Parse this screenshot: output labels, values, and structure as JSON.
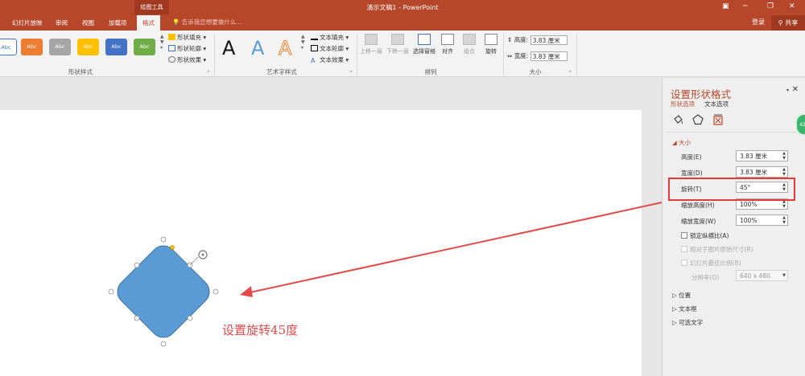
{
  "titlebar": {
    "doc_title": "演示文稿1 - PowerPoint",
    "context_label": "绘图工具",
    "tell_me": "告诉我您想要做什么...",
    "login": "登录",
    "share": "共享"
  },
  "tabs": [
    {
      "label": "幻灯片放映"
    },
    {
      "label": "审阅"
    },
    {
      "label": "视图"
    },
    {
      "label": "加载项"
    },
    {
      "label": "格式"
    }
  ],
  "ribbon": {
    "shape_styles": [
      {
        "label": "Abc",
        "color": "#ffffff"
      },
      {
        "label": "Abc",
        "color": "#ed7d31"
      },
      {
        "label": "Abc",
        "color": "#a5a5a5"
      },
      {
        "label": "Abc",
        "color": "#ffc000"
      },
      {
        "label": "Abc",
        "color": "#4472c4"
      },
      {
        "label": "Abc",
        "color": "#70ad47"
      }
    ],
    "shape_fill": "形状填充",
    "shape_outline": "形状轮廓",
    "shape_effects": "形状效果",
    "shape_styles_label": "形状样式",
    "wordart": [
      {
        "letter": "A",
        "color": "#111111"
      },
      {
        "letter": "A",
        "color": "#5b9bd5"
      },
      {
        "letter": "A",
        "color": "#ed7d31"
      }
    ],
    "text_fill": "文本填充",
    "text_outline": "文本轮廓",
    "text_effects": "文本效果",
    "wordart_label": "艺术字样式",
    "arrange": {
      "bring_forward": "上移一层",
      "send_backward": "下移一层",
      "selection_pane": "选择窗格",
      "align": "对齐",
      "group": "组合",
      "rotate": "旋转",
      "label": "排列"
    },
    "size": {
      "height_label": "高度:",
      "height_value": "3.83 厘米",
      "width_label": "宽度:",
      "width_value": "3.83 厘米",
      "label": "大小"
    }
  },
  "slide": {
    "annotation": "设置旋转45度",
    "shape_color": "#5b9bd5",
    "arrow_color": "#e53a3a"
  },
  "pane": {
    "title": "设置形状格式",
    "tab_shape": "形状选项",
    "tab_text": "文本选项",
    "size_section": "大小",
    "height_label": "高度(E)",
    "height_value": "3.83 厘米",
    "width_label": "宽度(D)",
    "width_value": "3.83 厘米",
    "rotation_label": "旋转(T)",
    "rotation_value": "45°",
    "scale_height_label": "缩放高度(H)",
    "scale_height_value": "100%",
    "scale_width_label": "缩放宽度(W)",
    "scale_width_value": "100%",
    "lock_aspect": "锁定纵横比(A)",
    "relative_original": "相对于图片原始尺寸(R)",
    "best_scale": "幻灯片最佳比例(B)",
    "resolution_label": "分辨率(O)",
    "resolution_value": "640 x 480",
    "position_section": "位置",
    "textbox_section": "文本框",
    "alttext_section": "可选文字",
    "badge_text": "42"
  }
}
